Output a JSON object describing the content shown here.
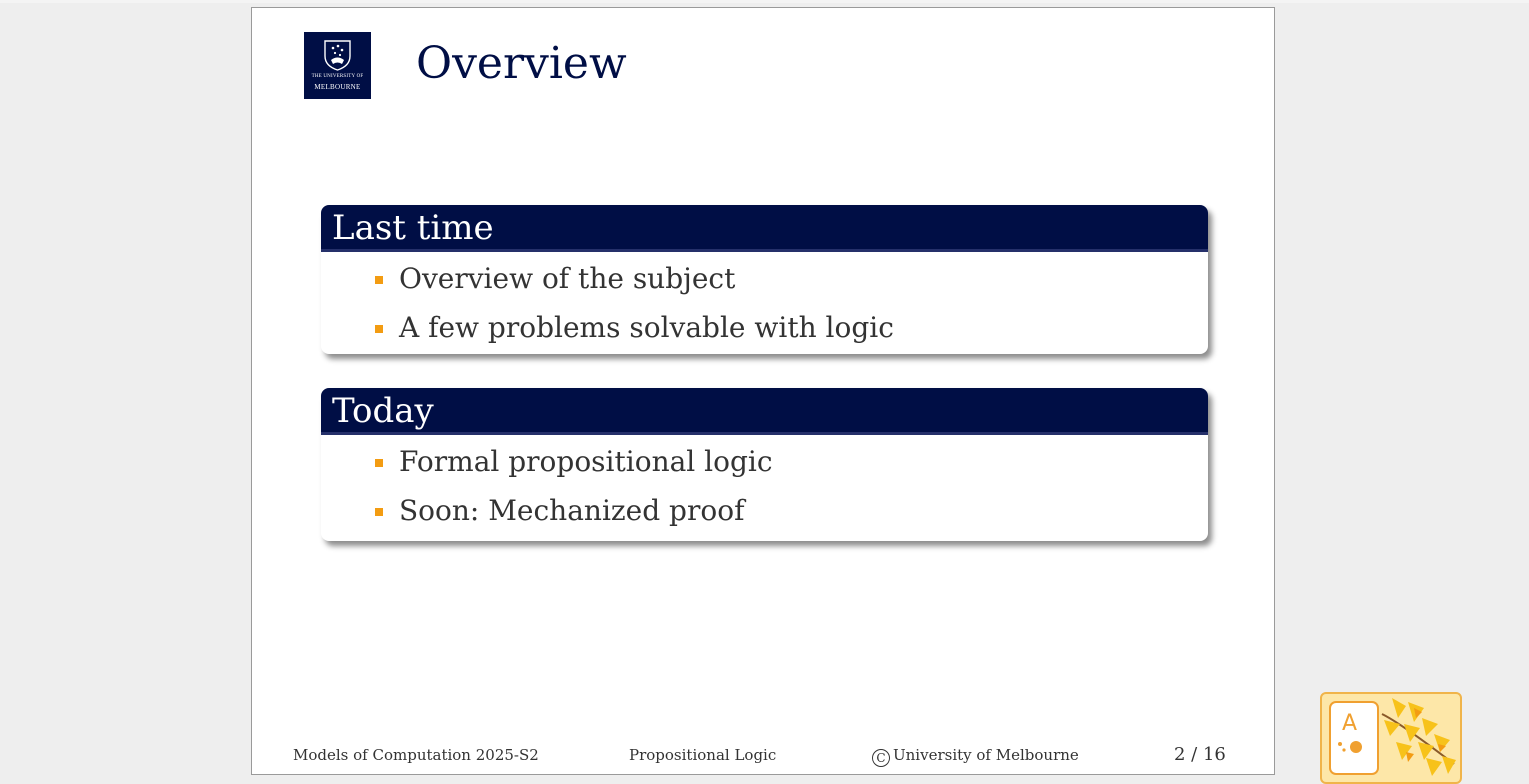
{
  "logo": {
    "line1": "THE UNIVERSITY OF",
    "line2": "MELBOURNE"
  },
  "slide": {
    "title": "Overview",
    "blocks": [
      {
        "title": "Last time",
        "items": [
          "Overview of the subject",
          "A few problems solvable with logic"
        ]
      },
      {
        "title": "Today",
        "items": [
          "Formal propositional logic",
          "Soon: Mechanized proof"
        ]
      }
    ]
  },
  "footer": {
    "subject": "Models of Computation 2025-S2",
    "topic": "Propositional Logic",
    "copyright_symbol": "C",
    "copyright": "University of Melbourne",
    "page": "2 / 16"
  },
  "ime": {
    "letter": "A"
  },
  "colors": {
    "navy": "#000e45",
    "bullet": "#f39c12",
    "text": "#333333"
  }
}
